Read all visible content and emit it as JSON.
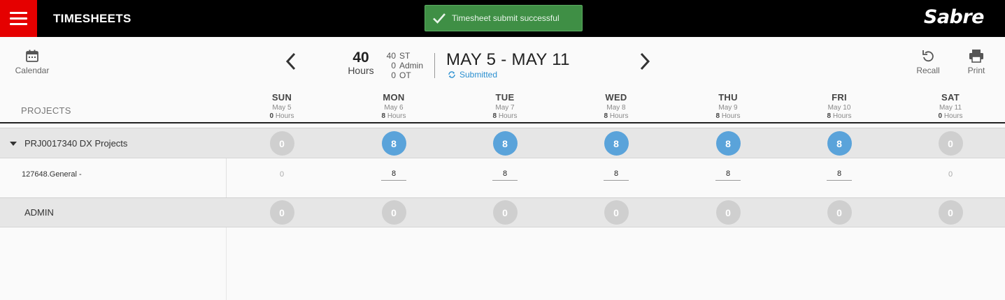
{
  "header": {
    "app_title": "TIMESHEETS",
    "toast": "Timesheet submit successful",
    "brand": "Sabre",
    "colors": {
      "topbar": "#000000",
      "menu": "#e50000",
      "toast": "#3f8f45",
      "accent": "#5aa3da"
    }
  },
  "toolbar": {
    "calendar_label": "Calendar",
    "recall_label": "Recall",
    "print_label": "Print"
  },
  "summary": {
    "total_hours": "40",
    "total_hours_label": "Hours",
    "breakdown": [
      {
        "value": "40",
        "label": "ST"
      },
      {
        "value": "0",
        "label": "Admin"
      },
      {
        "value": "0",
        "label": "OT"
      }
    ],
    "week_range": "MAY 5 - MAY 11",
    "status": "Submitted"
  },
  "grid": {
    "projects_header": "PROJECTS",
    "days": [
      {
        "name": "SUN",
        "date": "May 5",
        "hours": "0",
        "hours_unit": "Hours"
      },
      {
        "name": "MON",
        "date": "May 6",
        "hours": "8",
        "hours_unit": "Hours"
      },
      {
        "name": "TUE",
        "date": "May 7",
        "hours": "8",
        "hours_unit": "Hours"
      },
      {
        "name": "WED",
        "date": "May 8",
        "hours": "8",
        "hours_unit": "Hours"
      },
      {
        "name": "THU",
        "date": "May 9",
        "hours": "8",
        "hours_unit": "Hours"
      },
      {
        "name": "FRI",
        "date": "May 10",
        "hours": "8",
        "hours_unit": "Hours"
      },
      {
        "name": "SAT",
        "date": "May 11",
        "hours": "0",
        "hours_unit": "Hours"
      }
    ],
    "project": {
      "name": "PRJ0017340 DX Projects",
      "totals": [
        "0",
        "8",
        "8",
        "8",
        "8",
        "8",
        "0"
      ]
    },
    "task": {
      "name": "127648.General -",
      "values": [
        "0",
        "8",
        "8",
        "8",
        "8",
        "8",
        "0"
      ]
    },
    "admin": {
      "name": "ADMIN",
      "totals": [
        "0",
        "0",
        "0",
        "0",
        "0",
        "0",
        "0"
      ]
    }
  }
}
